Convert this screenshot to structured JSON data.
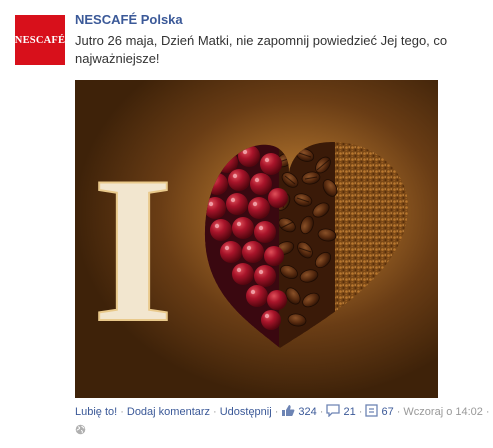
{
  "post": {
    "author": "NESCAFÉ Polska",
    "avatar_logo": "NESCAFÉ",
    "message": "Jutro 26 maja, Dzień Matki, nie zapomnij powiedzieć Jej tego, co najważniejsze!",
    "photo": {
      "letter": "I"
    },
    "actions": {
      "like_label": "Lubię to!",
      "comment_label": "Dodaj komentarz",
      "share_label": "Udostępnij",
      "likes_count": "324",
      "comments_count": "21",
      "shares_count": "67",
      "timestamp": "Wczoraj o 14:02"
    }
  },
  "colors": {
    "author_link": "#3b5998",
    "avatar_bg": "#d8101b",
    "meta_text": "#999999",
    "body_text": "#333333"
  },
  "icons": [
    "thumbs-up-icon",
    "comment-icon",
    "share-icon",
    "globe-icon"
  ]
}
